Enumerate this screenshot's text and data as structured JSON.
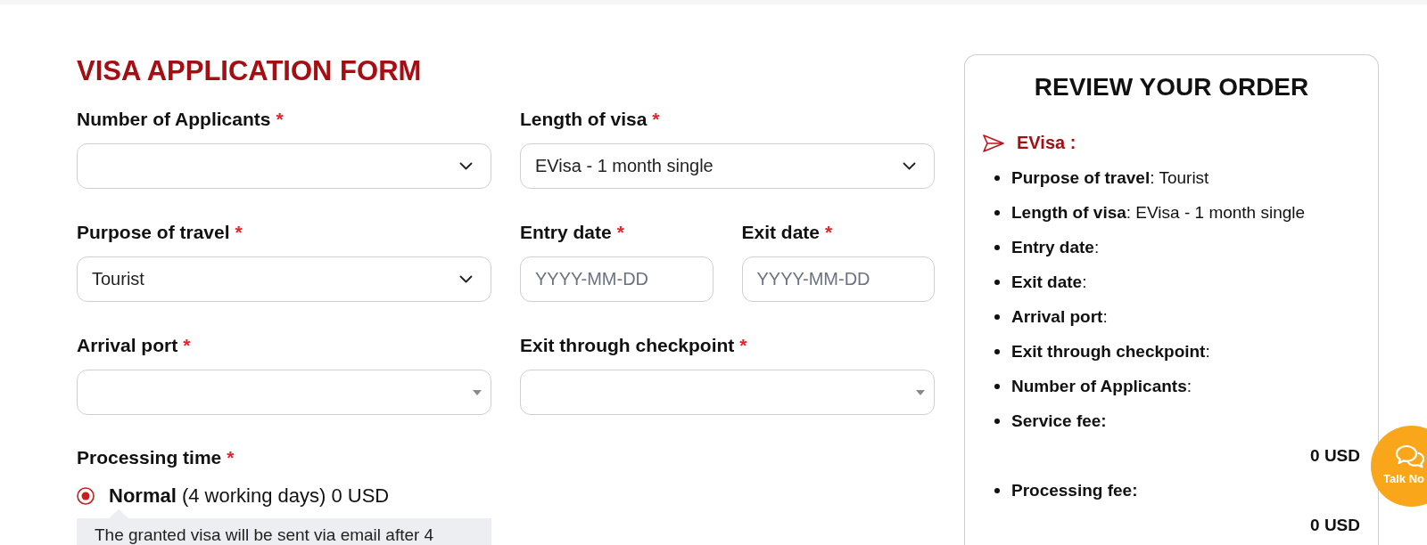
{
  "form": {
    "title": "VISA APPLICATION FORM",
    "fields": [
      {
        "kind": "select",
        "label": "Number of Applicants",
        "required_mark": "*"
      },
      {
        "kind": "select",
        "label": "Length of visa",
        "required_mark": "*",
        "value": "EVisa - 1 month single"
      },
      {
        "kind": "select",
        "label": "Purpose of travel",
        "required_mark": "*",
        "value": "Tourist"
      },
      {
        "kind": "date",
        "label": "Entry date",
        "required_mark": "*",
        "placeholder": "YYYY-MM-DD"
      },
      {
        "kind": "date",
        "label": "Exit date",
        "required_mark": "*",
        "placeholder": "YYYY-MM-DD"
      },
      {
        "kind": "combo",
        "label": "Arrival port",
        "required_mark": "*"
      },
      {
        "kind": "combo",
        "label": "Exit through checkpoint",
        "required_mark": "*"
      }
    ],
    "processing_time": {
      "label": "Processing time",
      "required_mark": "*",
      "options": [
        {
          "label": "**Normal** (4 working days) 0 USD",
          "selected": true
        }
      ],
      "note": "The granted visa will be sent via email after 4"
    }
  },
  "review": {
    "title": "REVIEW YOUR ORDER",
    "section": "EVisa :",
    "items": [
      {
        "kind": "detail",
        "text": "**Purpose of travel**: Tourist"
      },
      {
        "kind": "detail",
        "text": "**Length of visa**: EVisa - 1 month single"
      },
      {
        "kind": "detail",
        "text": "**Entry date**:"
      },
      {
        "kind": "detail",
        "text": "**Exit date**:"
      },
      {
        "kind": "detail",
        "text": "**Arrival port**:"
      },
      {
        "kind": "detail",
        "text": "**Exit through checkpoint**:"
      },
      {
        "kind": "detail",
        "text": "**Number of Applicants**:"
      },
      {
        "kind": "fee",
        "label": "Service fee:",
        "amount": "0 USD"
      },
      {
        "kind": "fee",
        "label": "Processing fee:",
        "amount": "0 USD"
      }
    ]
  },
  "chat_button": {
    "label": "Talk No"
  }
}
